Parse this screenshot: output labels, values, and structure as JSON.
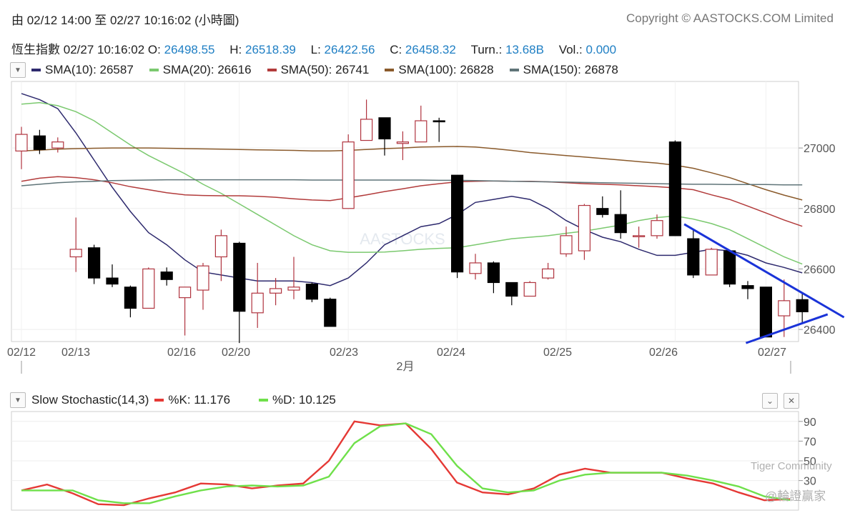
{
  "header": {
    "range": "由  02/12 14:00 至  02/27 10:16:02 (小時圖)",
    "copyright": "Copyright © AASTOCKS.COM Limited"
  },
  "quote": {
    "name": "恆生指數",
    "datetime": "02/27 10:16:02",
    "open_label": "O:",
    "open": "26498.55",
    "high_label": "H:",
    "high": "26518.39",
    "low_label": "L:",
    "low": "26422.56",
    "close_label": "C:",
    "close": "26458.32",
    "turnover_label": "Turn.:",
    "turnover": "13.68B",
    "volume_label": "Vol.:",
    "volume": "0.000"
  },
  "sma_legend": [
    {
      "label": "SMA(10): 26587",
      "color": "#2e2a6e"
    },
    {
      "label": "SMA(20): 26616",
      "color": "#7bc96f"
    },
    {
      "label": "SMA(50): 26741",
      "color": "#b23b3b"
    },
    {
      "label": "SMA(100): 26828",
      "color": "#8a5a2b"
    },
    {
      "label": "SMA(150): 26878",
      "color": "#5f7478"
    }
  ],
  "stoch_legend": {
    "title": "Slow Stochastic(14,3)",
    "k_label": "%K: 11.176",
    "k_color": "#e53935",
    "d_label": "%D: 10.125",
    "d_color": "#6fe04a"
  },
  "watermark": {
    "center": "AASTOCKS",
    "tiger": "Tiger Community",
    "author": "@輪證贏家"
  },
  "icons": {
    "collapse": "chevron-down-icon",
    "minimize": "minimize-icon",
    "close": "close-icon"
  },
  "chart_data": [
    {
      "type": "candlestick",
      "title": "恆生指數",
      "ylim": [
        26360,
        27220
      ],
      "yticks": [
        26400,
        26600,
        26800,
        27000
      ],
      "xticks": [
        "02/12",
        "02/13",
        "02/16",
        "02/20",
        "02/23",
        "02/24",
        "02/25",
        "02/26",
        "02/27"
      ],
      "month_label": "2月",
      "up_color": "#b0343f",
      "down_color": "#000000",
      "candles": [
        {
          "o": 26990,
          "h": 27070,
          "l": 26930,
          "c": 27045
        },
        {
          "o": 27040,
          "h": 27060,
          "l": 26980,
          "c": 26995
        },
        {
          "o": 27000,
          "h": 27035,
          "l": 26985,
          "c": 27020
        },
        {
          "o": 26640,
          "h": 26770,
          "l": 26590,
          "c": 26665
        },
        {
          "o": 26670,
          "h": 26680,
          "l": 26550,
          "c": 26570
        },
        {
          "o": 26570,
          "h": 26615,
          "l": 26540,
          "c": 26550
        },
        {
          "o": 26540,
          "h": 26545,
          "l": 26440,
          "c": 26470
        },
        {
          "o": 26470,
          "h": 26605,
          "l": 26470,
          "c": 26600
        },
        {
          "o": 26590,
          "h": 26605,
          "l": 26545,
          "c": 26565
        },
        {
          "o": 26505,
          "h": 26540,
          "l": 26380,
          "c": 26540
        },
        {
          "o": 26530,
          "h": 26620,
          "l": 26465,
          "c": 26610
        },
        {
          "o": 26640,
          "h": 26730,
          "l": 26560,
          "c": 26710
        },
        {
          "o": 26685,
          "h": 26690,
          "l": 26355,
          "c": 26460
        },
        {
          "o": 26455,
          "h": 26620,
          "l": 26405,
          "c": 26520
        },
        {
          "o": 26520,
          "h": 26570,
          "l": 26480,
          "c": 26535
        },
        {
          "o": 26530,
          "h": 26640,
          "l": 26500,
          "c": 26540
        },
        {
          "o": 26550,
          "h": 26555,
          "l": 26490,
          "c": 26500
        },
        {
          "o": 26500,
          "h": 26505,
          "l": 26410,
          "c": 26410
        },
        {
          "o": 26800,
          "h": 27045,
          "l": 26800,
          "c": 27020
        },
        {
          "o": 27025,
          "h": 27160,
          "l": 27025,
          "c": 27095
        },
        {
          "o": 27100,
          "h": 27100,
          "l": 26975,
          "c": 27030
        },
        {
          "o": 27015,
          "h": 27055,
          "l": 26960,
          "c": 27020
        },
        {
          "o": 27020,
          "h": 27140,
          "l": 27020,
          "c": 27090
        },
        {
          "o": 27090,
          "h": 27100,
          "l": 27020,
          "c": 27088
        },
        {
          "o": 26910,
          "h": 26910,
          "l": 26570,
          "c": 26590
        },
        {
          "o": 26585,
          "h": 26650,
          "l": 26565,
          "c": 26620
        },
        {
          "o": 26620,
          "h": 26625,
          "l": 26520,
          "c": 26555
        },
        {
          "o": 26555,
          "h": 26555,
          "l": 26480,
          "c": 26510
        },
        {
          "o": 26510,
          "h": 26560,
          "l": 26510,
          "c": 26555
        },
        {
          "o": 26570,
          "h": 26620,
          "l": 26565,
          "c": 26600
        },
        {
          "o": 26650,
          "h": 26740,
          "l": 26640,
          "c": 26710
        },
        {
          "o": 26660,
          "h": 26815,
          "l": 26630,
          "c": 26810
        },
        {
          "o": 26800,
          "h": 26840,
          "l": 26770,
          "c": 26780
        },
        {
          "o": 26780,
          "h": 26860,
          "l": 26700,
          "c": 26720
        },
        {
          "o": 26710,
          "h": 26740,
          "l": 26670,
          "c": 26710
        },
        {
          "o": 26710,
          "h": 26780,
          "l": 26700,
          "c": 26760
        },
        {
          "o": 27020,
          "h": 27025,
          "l": 26710,
          "c": 26710
        },
        {
          "o": 26700,
          "h": 26730,
          "l": 26570,
          "c": 26580
        },
        {
          "o": 26580,
          "h": 26670,
          "l": 26580,
          "c": 26665
        },
        {
          "o": 26660,
          "h": 26660,
          "l": 26540,
          "c": 26550
        },
        {
          "o": 26545,
          "h": 26560,
          "l": 26500,
          "c": 26535
        },
        {
          "o": 26540,
          "h": 26540,
          "l": 26375,
          "c": 26375
        },
        {
          "o": 26445,
          "h": 26565,
          "l": 26375,
          "c": 26495
        },
        {
          "o": 26498.55,
          "h": 26518.39,
          "l": 26422.56,
          "c": 26458.32
        }
      ],
      "series": [
        {
          "name": "SMA(10)",
          "color": "#2e2a6e",
          "values": [
            27180,
            27160,
            27130,
            27050,
            26960,
            26870,
            26790,
            26720,
            26680,
            26630,
            26590,
            26580,
            26570,
            26560,
            26560,
            26560,
            26555,
            26545,
            26570,
            26620,
            26680,
            26710,
            26740,
            26750,
            26780,
            26820,
            26830,
            26840,
            26830,
            26800,
            26760,
            26730,
            26705,
            26690,
            26665,
            26645,
            26645,
            26655,
            26665,
            26660,
            26645,
            26620,
            26605,
            26587
          ]
        },
        {
          "name": "SMA(20)",
          "color": "#7bc96f",
          "values": [
            27145,
            27150,
            27140,
            27120,
            27090,
            27050,
            27010,
            26975,
            26945,
            26915,
            26880,
            26850,
            26815,
            26780,
            26745,
            26710,
            26680,
            26660,
            26655,
            26655,
            26656,
            26660,
            26665,
            26668,
            26670,
            26680,
            26690,
            26700,
            26705,
            26710,
            26718,
            26725,
            26735,
            26745,
            26760,
            26770,
            26775,
            26765,
            26750,
            26730,
            26700,
            26670,
            26640,
            26616
          ]
        },
        {
          "name": "SMA(50)",
          "color": "#b23b3b",
          "values": [
            26890,
            26900,
            26905,
            26902,
            26895,
            26885,
            26872,
            26862,
            26852,
            26845,
            26843,
            26842,
            26842,
            26840,
            26837,
            26832,
            26828,
            26826,
            26835,
            26845,
            26856,
            26865,
            26875,
            26882,
            26888,
            26890,
            26891,
            26890,
            26890,
            26888,
            26885,
            26882,
            26880,
            26878,
            26875,
            26872,
            26868,
            26862,
            26845,
            26830,
            26808,
            26785,
            26762,
            26741
          ]
        },
        {
          "name": "SMA(100)",
          "color": "#8a5a2b",
          "values": [
            26990,
            26993,
            26996,
            26998,
            26999,
            27000,
            27000,
            27000,
            26999,
            26998,
            26997,
            26996,
            26995,
            26994,
            26993,
            26992,
            26990,
            26990,
            26992,
            26995,
            26998,
            27000,
            27003,
            27004,
            27005,
            27003,
            26998,
            26992,
            26985,
            26980,
            26975,
            26970,
            26965,
            26960,
            26955,
            26950,
            26943,
            26933,
            26918,
            26902,
            26882,
            26862,
            26844,
            26828
          ]
        },
        {
          "name": "SMA(150)",
          "color": "#5f7478",
          "values": [
            26875,
            26880,
            26885,
            26888,
            26890,
            26892,
            26893,
            26894,
            26895,
            26895,
            26895,
            26895,
            26895,
            26895,
            26895,
            26895,
            26894,
            26894,
            26894,
            26894,
            26894,
            26894,
            26894,
            26893,
            26893,
            26892,
            26891,
            26890,
            26889,
            26888,
            26887,
            26886,
            26885,
            26884,
            26883,
            26882,
            26881,
            26880,
            26880,
            26879,
            26879,
            26879,
            26878,
            26878
          ]
        }
      ],
      "annotations": [
        {
          "type": "trendline",
          "color": "#1a33d8",
          "from": {
            "i": 36.5,
            "y": 26748
          },
          "to": {
            "i": 45.3,
            "y": 26440
          }
        },
        {
          "type": "trendline",
          "color": "#1a33d8",
          "from": {
            "i": 39.9,
            "y": 26355
          },
          "to": {
            "i": 44.4,
            "y": 26450
          }
        }
      ]
    },
    {
      "type": "line",
      "title": "Slow Stochastic(14,3)",
      "ylim": [
        0,
        100
      ],
      "yticks": [
        30,
        50,
        70,
        90
      ],
      "tick_labels": [
        "30",
        "50",
        "70",
        "90"
      ],
      "series": [
        {
          "name": "%K",
          "color": "#e53935",
          "values": [
            20,
            26,
            17,
            6,
            5,
            12,
            18,
            27,
            26,
            22,
            25,
            27,
            50,
            90,
            86,
            88,
            62,
            28,
            18,
            16,
            22,
            36,
            42,
            38,
            38,
            38,
            32,
            27,
            18,
            10,
            11.176
          ]
        },
        {
          "name": "%D",
          "color": "#6fe04a",
          "values": [
            20,
            20,
            20,
            10,
            7,
            7,
            14,
            20,
            24,
            25,
            24,
            25,
            34,
            68,
            85,
            88,
            77,
            45,
            22,
            18,
            20,
            30,
            36,
            38,
            38,
            38,
            35,
            30,
            24,
            14,
            10.125
          ]
        }
      ]
    }
  ]
}
